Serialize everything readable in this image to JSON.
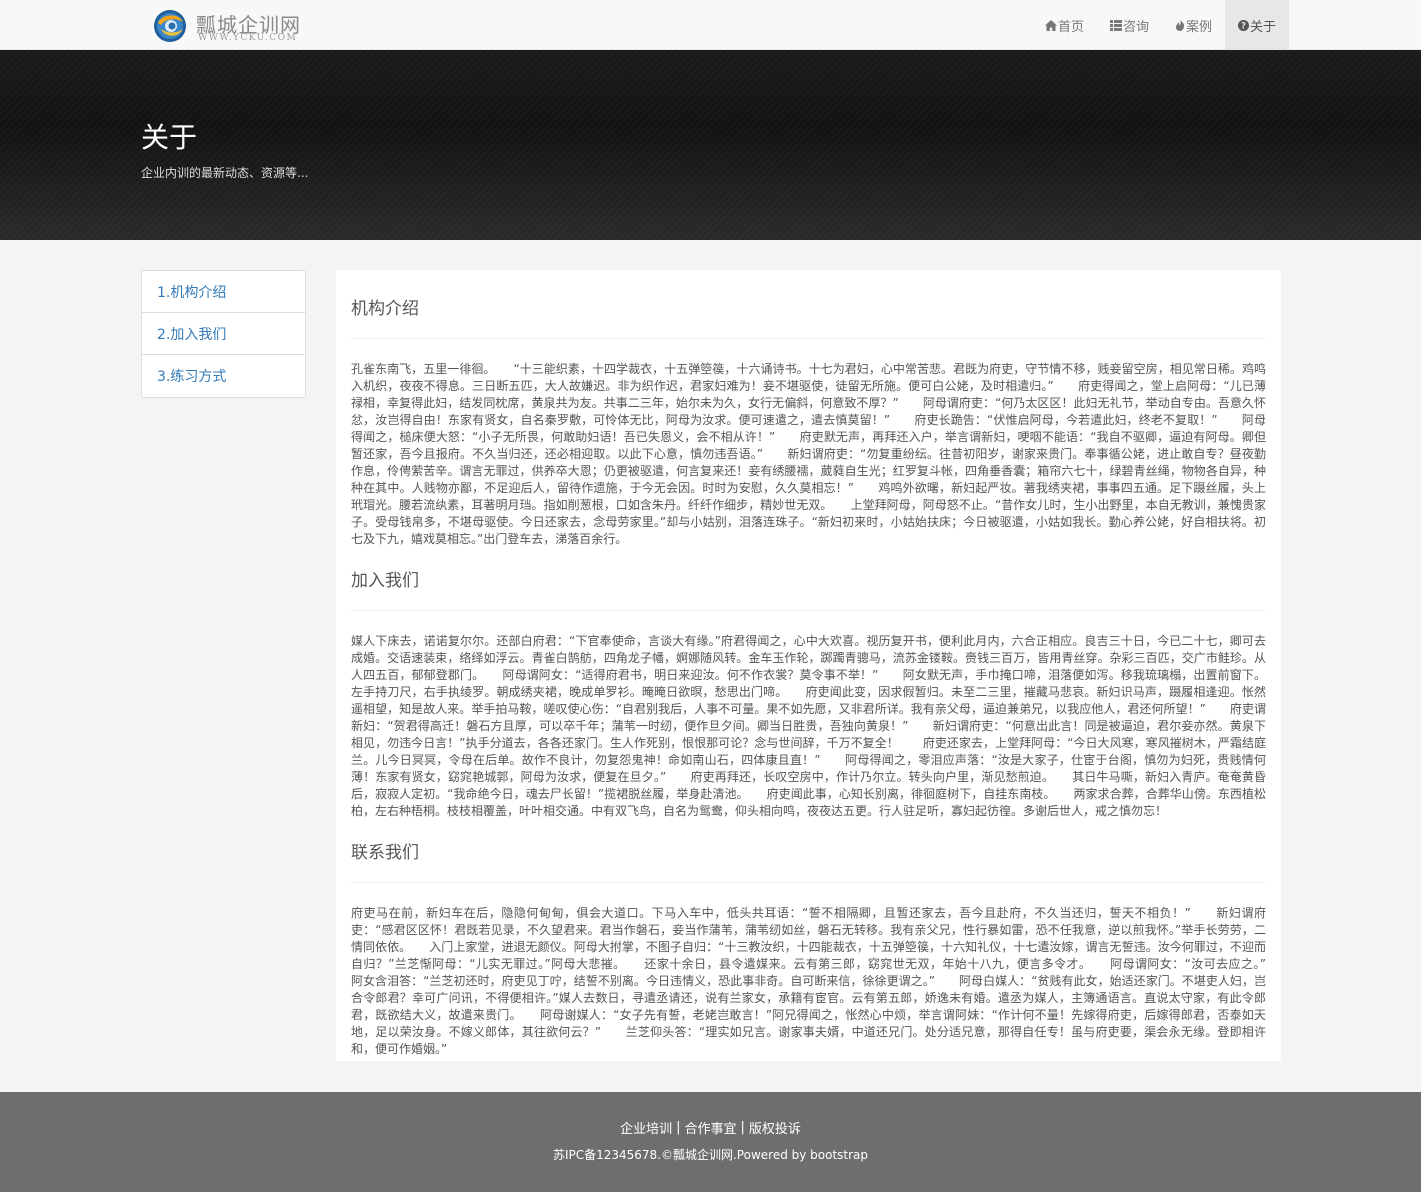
{
  "brand": {
    "name": "瓢城企训网",
    "url_text": "WWW.YCKU.COM"
  },
  "nav": [
    {
      "label": "首页",
      "icon": "home-icon"
    },
    {
      "label": "咨询",
      "icon": "list-icon"
    },
    {
      "label": "案例",
      "icon": "fire-icon"
    },
    {
      "label": "关于",
      "icon": "question-circle-icon",
      "active": true
    }
  ],
  "banner": {
    "title": "关于",
    "subtitle": "企业内训的最新动态、资源等..."
  },
  "sidebar": {
    "items": [
      {
        "label": "1.机构介绍"
      },
      {
        "label": "2.加入我们"
      },
      {
        "label": "3.练习方式"
      }
    ]
  },
  "sections": [
    {
      "title": "机构介绍",
      "body": "孔雀东南飞，五里一徘徊。　　“十三能织素，十四学裁衣，十五弹箜篌，十六诵诗书。十七为君妇，心中常苦悲。君既为府吏，守节情不移，贱妾留空房，相见常日稀。鸡鸣入机织，夜夜不得息。三日断五匹，大人故嫌迟。非为织作迟，君家妇难为！妾不堪驱使，徒留无所施。便可白公姥，及时相遣归。”　　府吏得闻之，堂上启阿母：“儿已薄禄相，幸复得此妇，结发同枕席，黄泉共为友。共事二三年，始尔未为久，女行无偏斜，何意致不厚？”　　阿母谓府吏：“何乃太区区！此妇无礼节，举动自专由。吾意久怀忿，汝岂得自由！东家有贤女，自名秦罗敷，可怜体无比，阿母为汝求。便可速遣之，遣去慎莫留！”　　府吏长跪告：“伏惟启阿母，今若遣此妇，终老不复取！”　　阿母得闻之，槌床便大怒：“小子无所畏，何敢助妇语！吾已失恩义，会不相从许！”　　府吏默无声，再拜还入户，举言谓新妇，哽咽不能语：“我自不驱卿，逼迫有阿母。卿但暂还家，吾今且报府。不久当归还，还必相迎取。以此下心意，慎勿违吾语。”　　新妇谓府吏：“勿复重纷纭。往昔初阳岁，谢家来贵门。奉事循公姥，进止敢自专？昼夜勤作息，伶俜萦苦辛。谓言无罪过，供养卒大恩；仍更被驱遣，何言复来还！妾有绣腰襦，葳蕤自生光；红罗复斗帐，四角垂香囊；箱帘六七十，绿碧青丝绳，物物各自异，种种在其中。人贱物亦鄙，不足迎后人，留待作遗施，于今无会因。时时为安慰，久久莫相忘！”　　鸡鸣外欲曙，新妇起严妆。著我绣夹裙，事事四五通。足下蹑丝履，头上玳瑁光。腰若流纨素，耳著明月珰。指如削葱根，口如含朱丹。纤纤作细步，精妙世无双。　　上堂拜阿母，阿母怒不止。“昔作女儿时，生小出野里，本自无教训，兼愧贵家子。受母钱帛多，不堪母驱使。今日还家去，念母劳家里。”却与小姑别，泪落连珠子。“新妇初来时，小姑始扶床；今日被驱遣，小姑如我长。勤心养公姥，好自相扶将。初七及下九，嬉戏莫相忘。”出门登车去，涕落百余行。"
    },
    {
      "title": "加入我们",
      "body": "媒人下床去，诺诺复尔尔。还部白府君：“下官奉使命，言谈大有缘。”府君得闻之，心中大欢喜。视历复开书，便利此月内，六合正相应。良吉三十日，今已二十七，卿可去成婚。交语速装束，络绎如浮云。青雀白鹄舫，四角龙子幡，婀娜随风转。金车玉作轮，踯躅青骢马，流苏金镂鞍。赍钱三百万，皆用青丝穿。杂彩三百匹，交广市鲑珍。从人四五百，郁郁登郡门。　　阿母谓阿女：“适得府君书，明日来迎汝。何不作衣裳？莫令事不举！”　　阿女默无声，手巾掩口啼，泪落便如泻。移我琉璃榻，出置前窗下。左手持刀尺，右手执绫罗。朝成绣夹裙，晚成单罗衫。晻晻日欲暝，愁思出门啼。　　府吏闻此变，因求假暂归。未至二三里，摧藏马悲哀。新妇识马声，蹑履相逢迎。怅然遥相望，知是故人来。举手拍马鞍，嗟叹使心伤：“自君别我后，人事不可量。果不如先愿，又非君所详。我有亲父母，逼迫兼弟兄，以我应他人，君还何所望！”　　府吏谓新妇：“贺君得高迁！磐石方且厚，可以卒千年；蒲苇一时纫，便作旦夕间。卿当日胜贵，吾独向黄泉！”　　新妇谓府吏：“何意出此言！同是被逼迫，君尔妾亦然。黄泉下相见，勿违今日言！”执手分道去，各各还家门。生人作死别，恨恨那可论？念与世间辞，千万不复全！　　府吏还家去，上堂拜阿母：“今日大风寒，寒风摧树木，严霜结庭兰。儿今日冥冥，令母在后单。故作不良计，勿复怨鬼神！命如南山石，四体康且直！”　　阿母得闻之，零泪应声落：“汝是大家子，仕宦于台阁，慎勿为妇死，贵贱情何薄！东家有贤女，窈窕艳城郭，阿母为汝求，便复在旦夕。”　　府吏再拜还，长叹空房中，作计乃尔立。转头向户里，渐见愁煎迫。　　其日牛马嘶，新妇入青庐。奄奄黄昏后，寂寂人定初。“我命绝今日，魂去尸长留！”揽裙脱丝履，举身赴清池。　　府吏闻此事，心知长别离，徘徊庭树下，自挂东南枝。　　两家求合葬，合葬华山傍。东西植松柏，左右种梧桐。枝枝相覆盖，叶叶相交通。中有双飞鸟，自名为鸳鸯，仰头相向鸣，夜夜达五更。行人驻足听，寡妇起彷徨。多谢后世人，戒之慎勿忘！"
    },
    {
      "title": "联系我们",
      "body": "府吏马在前，新妇车在后，隐隐何甸甸，俱会大道口。下马入车中，低头共耳语：“誓不相隔卿，且暂还家去，吾今且赴府，不久当还归，誓天不相负！”　　新妇谓府吏：“感君区区怀！君既若见录，不久望君来。君当作磐石，妾当作蒲苇，蒲苇纫如丝，磐石无转移。我有亲父兄，性行暴如雷，恐不任我意，逆以煎我怀。”举手长劳劳，二情同依依。　　入门上家堂，进退无颜仪。阿母大拊掌，不图子自归：“十三教汝织，十四能裁衣，十五弹箜篌，十六知礼仪，十七遣汝嫁，谓言无誓违。汝今何罪过，不迎而自归？”兰芝惭阿母：“儿实无罪过。”阿母大悲摧。　　还家十余日，县令遣媒来。云有第三郎，窈窕世无双，年始十八九，便言多令才。　　阿母谓阿女：“汝可去应之。”　　阿女含泪答：“兰芝初还时，府吏见丁咛，结誓不别离。今日违情义，恐此事非奇。自可断来信，徐徐更谓之。”　　阿母白媒人：“贫贱有此女，始适还家门。不堪吏人妇，岂合令郎君？幸可广问讯，不得便相许。”媒人去数日，寻遣丞请还，说有兰家女，承籍有宦官。云有第五郎，娇逸未有婚。遣丞为媒人，主簿通语言。直说太守家，有此令郎君，既欲结大义，故遣来贵门。　　阿母谢媒人：“女子先有誓，老姥岂敢言！”阿兄得闻之，怅然心中烦，举言谓阿妹：“作计何不量！先嫁得府吏，后嫁得郎君，否泰如天地，足以荣汝身。不嫁义郎体，其往欲何云？”　　兰芝仰头答：“理实如兄言。谢家事夫婿，中道还兄门。处分适兄意，那得自任专！虽与府吏要，渠会永无缘。登即相许和，便可作婚姻。”"
    }
  ],
  "footer": {
    "links": [
      "企业培训",
      "合作事宜",
      "版权投诉"
    ],
    "separator": "|",
    "copyright": "苏IPC备12345678.©瓢城企训网.Powered by bootstrap"
  }
}
